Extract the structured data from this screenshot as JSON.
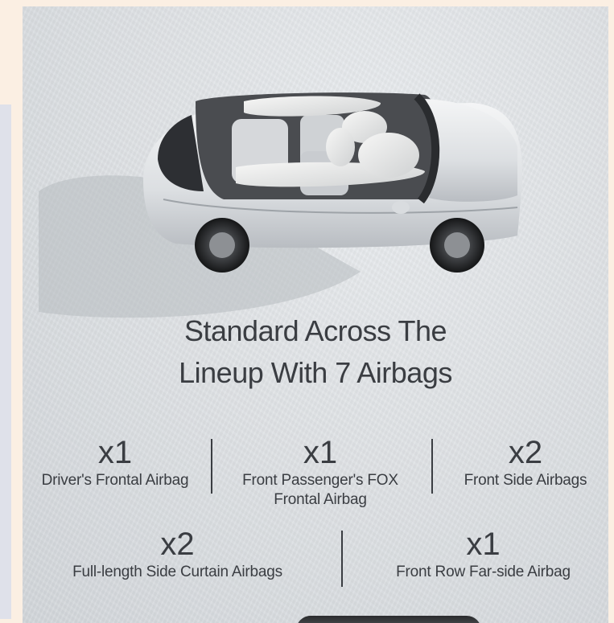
{
  "headline": {
    "line1": "Standard Across The",
    "line2": "Lineup With 7 Airbags"
  },
  "airbags": [
    {
      "count": "x1",
      "label_line1": "Driver's Frontal Airbag",
      "label_line2": ""
    },
    {
      "count": "x1",
      "label_line1": "Front Passenger's FOX",
      "label_line2": "Frontal Airbag"
    },
    {
      "count": "x2",
      "label_line1": "Front Side Airbags",
      "label_line2": ""
    },
    {
      "count": "x2",
      "label_line1": "Full-length Side Curtain Airbags",
      "label_line2": ""
    },
    {
      "count": "x1",
      "label_line1": "Front Row Far-side Airbag",
      "label_line2": ""
    }
  ],
  "colors": {
    "page_background": "#fbefe3",
    "side_panel": "#dfe1ea",
    "text": "#3a3d42"
  },
  "image": {
    "subject": "car-airbags-image"
  }
}
